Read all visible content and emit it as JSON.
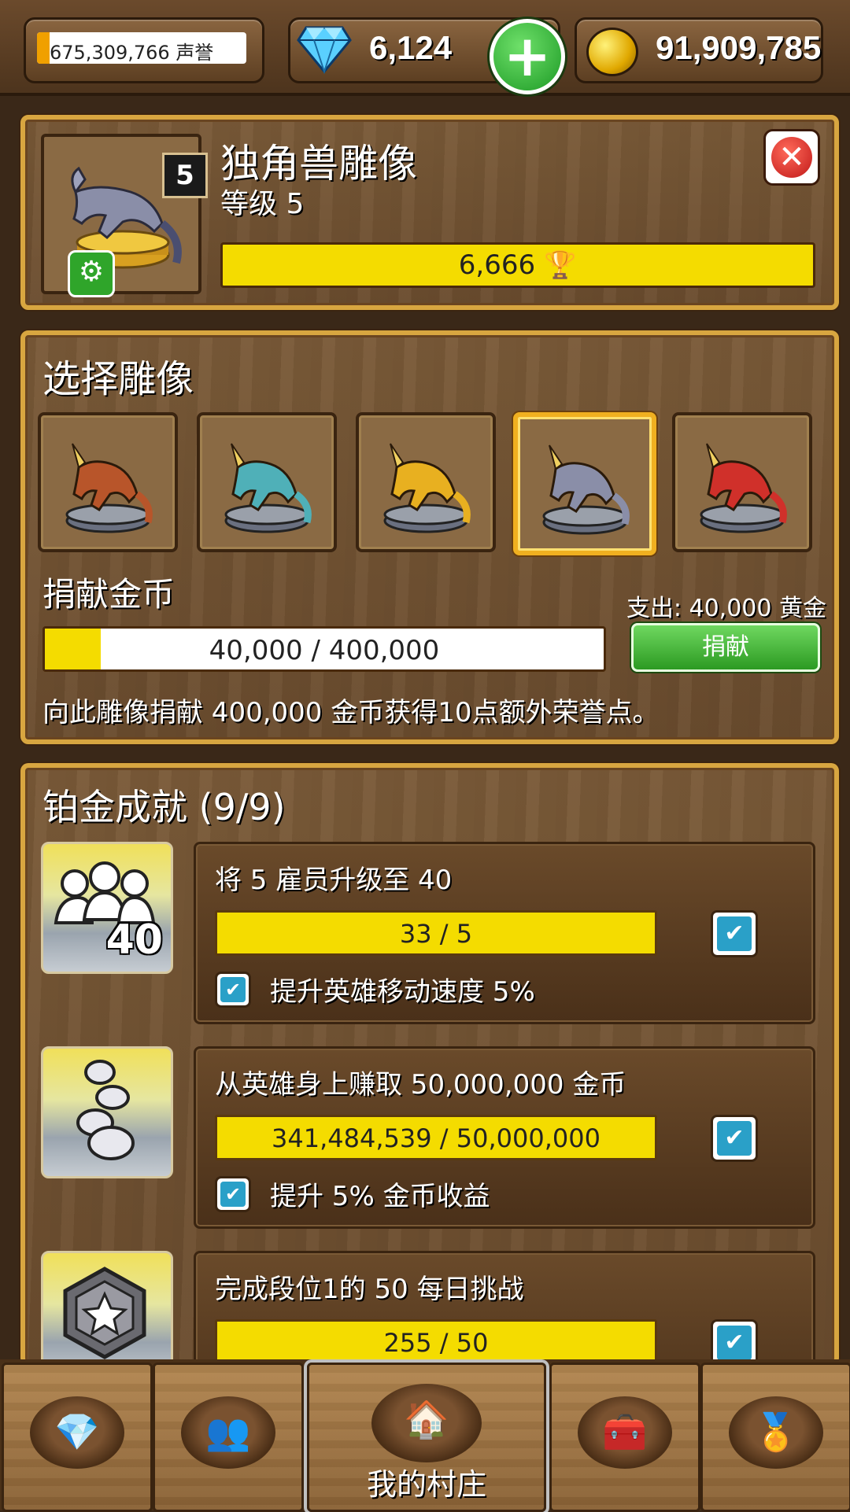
{
  "topbar": {
    "reputation_text": "675,309,766 声誉",
    "reputation_progress": 0.06,
    "gems": "6,124",
    "gold": "91,909,785",
    "icons": {
      "gem": "diamond-icon",
      "add": "plus-icon",
      "coin": "gold-coin-icon"
    }
  },
  "statue": {
    "name": "独角兽雕像",
    "level_label": "等级 5",
    "level_badge": "5",
    "score": "6,666",
    "close_symbol": "✕",
    "icons": {
      "settings": "gear-icon",
      "trophy": "trophy-icon"
    }
  },
  "selection": {
    "title": "选择雕像",
    "selected_index": 3,
    "statues": [
      {
        "name": "bronze-unicorn-statue",
        "color": "#b8552a"
      },
      {
        "name": "teal-unicorn-statue",
        "color": "#4fb0b8"
      },
      {
        "name": "gold-unicorn-statue",
        "color": "#e8b020"
      },
      {
        "name": "silver-unicorn-statue",
        "color": "#8a8ea8"
      },
      {
        "name": "red-winged-unicorn-statue",
        "color": "#d0302a"
      }
    ]
  },
  "donation": {
    "title": "捐献金币",
    "cost": "支出: 40,000 黄金",
    "progress_text": "40,000 / 400,000",
    "progress": 0.1,
    "button_label": "捐献",
    "description": "向此雕像捐献 400,000 金币获得10点额外荣誉点。"
  },
  "achievements": {
    "title": "铂金成就 (9/9)",
    "items": [
      {
        "title": "将 5 雇员升级至 40",
        "progress": "33 / 5",
        "reward": "提升英雄移动速度 5%",
        "icon": "employees-40-icon",
        "icon_text": "40"
      },
      {
        "title": "从英雄身上赚取 50,000,000 金币",
        "progress": "341,484,539 / 50,000,000",
        "reward": "提升 5% 金币收益",
        "icon": "silver-coins-icon"
      },
      {
        "title": "完成段位1的 50 每日挑战",
        "progress": "255 / 50",
        "reward": "",
        "icon": "star-hexagon-icon"
      }
    ],
    "check_symbol": "✔"
  },
  "nav": {
    "items": [
      {
        "icon": "diamond-icon",
        "glyph": "💎"
      },
      {
        "icon": "heroes-icon",
        "glyph": "👥"
      },
      {
        "icon": "home-icon",
        "glyph": "🏠",
        "label": "我的村庄"
      },
      {
        "icon": "treasure-chest-icon",
        "glyph": "🧰"
      },
      {
        "icon": "medal-icon",
        "glyph": "🏅"
      }
    ]
  }
}
